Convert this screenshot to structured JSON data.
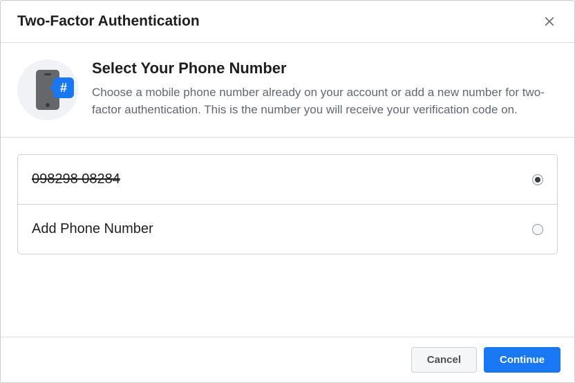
{
  "header": {
    "title": "Two-Factor Authentication"
  },
  "intro": {
    "title": "Select Your Phone Number",
    "description": "Choose a mobile phone number already on your account or add a new number for two-factor authentication. This is the number you will receive your verification code on."
  },
  "options": [
    {
      "label": "098298 08284",
      "selected": true,
      "strikethrough": true
    },
    {
      "label": "Add Phone Number",
      "selected": false,
      "strikethrough": false
    }
  ],
  "footer": {
    "cancel": "Cancel",
    "continue": "Continue"
  },
  "icons": {
    "badge_symbol": "#"
  }
}
